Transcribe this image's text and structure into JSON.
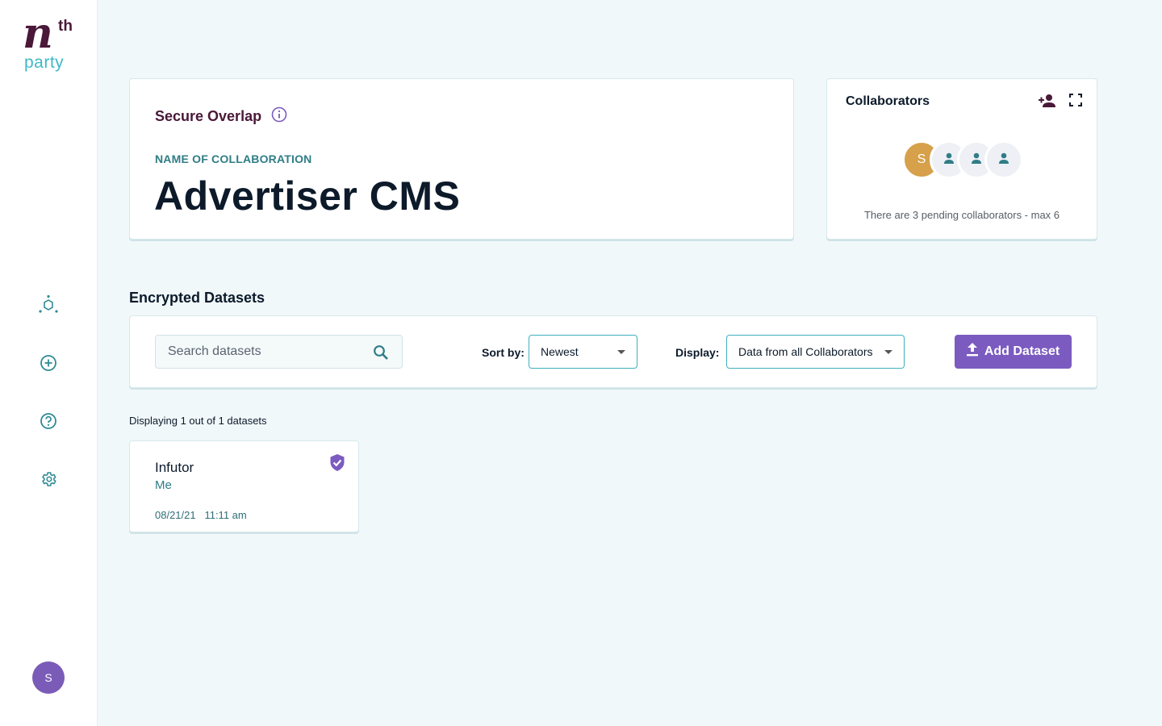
{
  "app": {
    "logo_mark": "n",
    "logo_superscript": "th",
    "logo_word": "party"
  },
  "sidebar": {
    "items": [
      {
        "icon": "network-hexagon-icon"
      },
      {
        "icon": "add-circle-icon"
      },
      {
        "icon": "help-icon"
      },
      {
        "icon": "gear-icon"
      }
    ],
    "user_initial": "S"
  },
  "overview": {
    "title": "Secure Overlap",
    "name_label": "NAME OF COLLABORATION",
    "name": "Advertiser CMS"
  },
  "collaborators": {
    "title": "Collaborators",
    "owner_initial": "S",
    "pending_text": "There are 3 pending collaborators - max 6"
  },
  "datasets": {
    "section_title": "Encrypted Datasets",
    "search_placeholder": "Search datasets",
    "sort_label": "Sort by:",
    "sort_value": "Newest",
    "display_label": "Display:",
    "display_value": "Data from all Collaborators",
    "add_button": "Add Dataset",
    "count_text": "Displaying 1 out of 1 datasets",
    "items": [
      {
        "name": "Infutor",
        "owner": "Me",
        "date": "08/21/21",
        "time": "11:11 am"
      }
    ]
  },
  "colors": {
    "brand_plum": "#4a1838",
    "brand_teal": "#3fb8c8",
    "accent_purple": "#7b5bc0",
    "owner_avatar": "#d7a04a"
  }
}
